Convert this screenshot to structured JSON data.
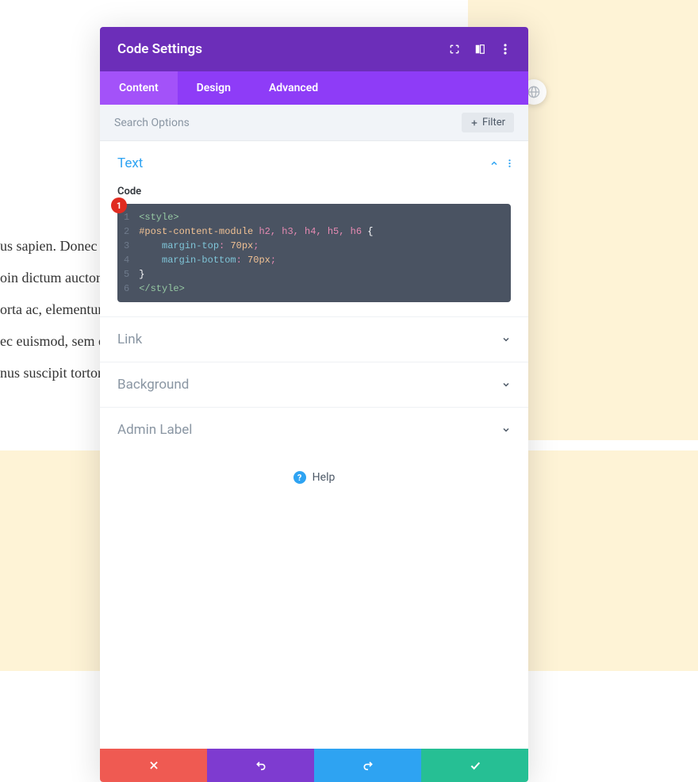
{
  "header": {
    "title": "Code Settings"
  },
  "tabs": {
    "content": "Content",
    "design": "Design",
    "advanced": "Advanced"
  },
  "search": {
    "placeholder": "Search Options",
    "filter_label": "Filter"
  },
  "sections": {
    "text": {
      "title": "Text",
      "code_label": "Code"
    },
    "link": {
      "title": "Link"
    },
    "background": {
      "title": "Background"
    },
    "admin_label": {
      "title": "Admin Label"
    }
  },
  "badge": "1",
  "code": {
    "lines": [
      "1",
      "2",
      "3",
      "4",
      "5",
      "6"
    ],
    "l1": "<style>",
    "l2_sel": "#post-content-module ",
    "l2_tags": "h2, h3, h4, h5, h6 ",
    "l2_brace": "{",
    "l3_prop": "margin-top",
    "l3_val": "70px",
    "l4_prop": "margin-bottom",
    "l4_val": "70px",
    "l6": "</style>"
  },
  "help": {
    "label": "Help"
  },
  "bg_text": {
    "l1": "us sapien. Donec p",
    "l2": "oin dictum auctor n",
    "l3": "orta ac, elementum",
    "l4": "ec euismod, sem et",
    "l5": "nus suscipit tortor"
  }
}
